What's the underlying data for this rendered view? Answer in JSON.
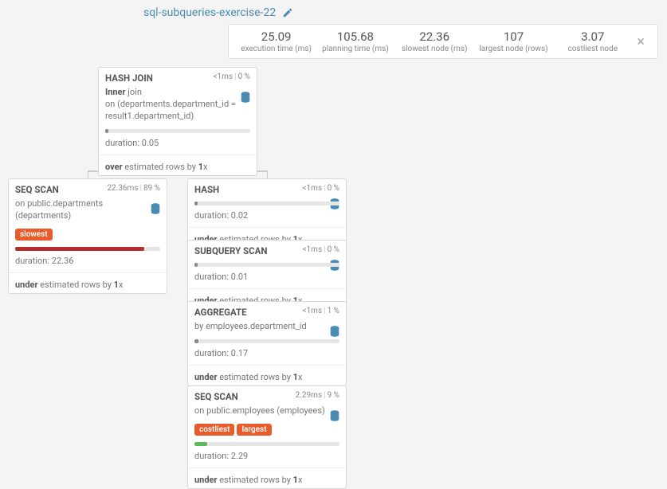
{
  "title": "sql-subqueries-exercise-22",
  "summary": {
    "items": [
      {
        "value": "25.09",
        "label": "execution time (ms)"
      },
      {
        "value": "105.68",
        "label": "planning time (ms)"
      },
      {
        "value": "22.36",
        "label": "slowest node (ms)"
      },
      {
        "value": "107",
        "label": "largest node (rows)"
      },
      {
        "value": "3.07",
        "label": "costliest node"
      }
    ]
  },
  "nodes": {
    "hashjoin": {
      "title": "HASH JOIN",
      "time": "<1ms",
      "pct": "0 %",
      "line1_pre": "Inner",
      "line1_post": " join",
      "line2": "on (departments.department_id = result1.department_id)",
      "duration_pre": "duration: ",
      "duration": "0.05",
      "estrow_pre": "over",
      "estrow_mid": " estimated rows by ",
      "estrow_val": "1",
      "estrow_suf": "x"
    },
    "seqscan1": {
      "title": "SEQ SCAN",
      "time": "22.36ms",
      "pct": "89 %",
      "on_pre": "on ",
      "on": "public.departments (departments)",
      "badge": "slowest",
      "duration_pre": "duration: ",
      "duration": "22.36",
      "estrow_pre": "under",
      "estrow_mid": " estimated rows by ",
      "estrow_val": "1",
      "estrow_suf": "x"
    },
    "hash": {
      "title": "HASH",
      "time": "<1ms",
      "pct": "0 %",
      "duration_pre": "duration: ",
      "duration": "0.02",
      "estrow_pre": "under",
      "estrow_mid": " estimated rows by ",
      "estrow_val": "1",
      "estrow_suf": "x"
    },
    "subq": {
      "title": "SUBQUERY SCAN",
      "time": "<1ms",
      "pct": "0 %",
      "duration_pre": "duration: ",
      "duration": "0.01",
      "estrow_pre": "under",
      "estrow_mid": " estimated rows by ",
      "estrow_val": "1",
      "estrow_suf": "x"
    },
    "agg": {
      "title": "AGGREGATE",
      "time": "<1ms",
      "pct": "1 %",
      "by_pre": "by ",
      "by": "employees.department_id",
      "duration_pre": "duration: ",
      "duration": "0.17",
      "estrow_pre": "under",
      "estrow_mid": " estimated rows by ",
      "estrow_val": "1",
      "estrow_suf": "x"
    },
    "seqscan2": {
      "title": "SEQ SCAN",
      "time": "2.29ms",
      "pct": "9 %",
      "on_pre": "on ",
      "on": "public.employees (employees)",
      "badge1": "costliest",
      "badge2": "largest",
      "duration_pre": "duration: ",
      "duration": "2.29",
      "estrow_pre": "under",
      "estrow_mid": " estimated rows by ",
      "estrow_val": "1",
      "estrow_suf": "x"
    }
  }
}
